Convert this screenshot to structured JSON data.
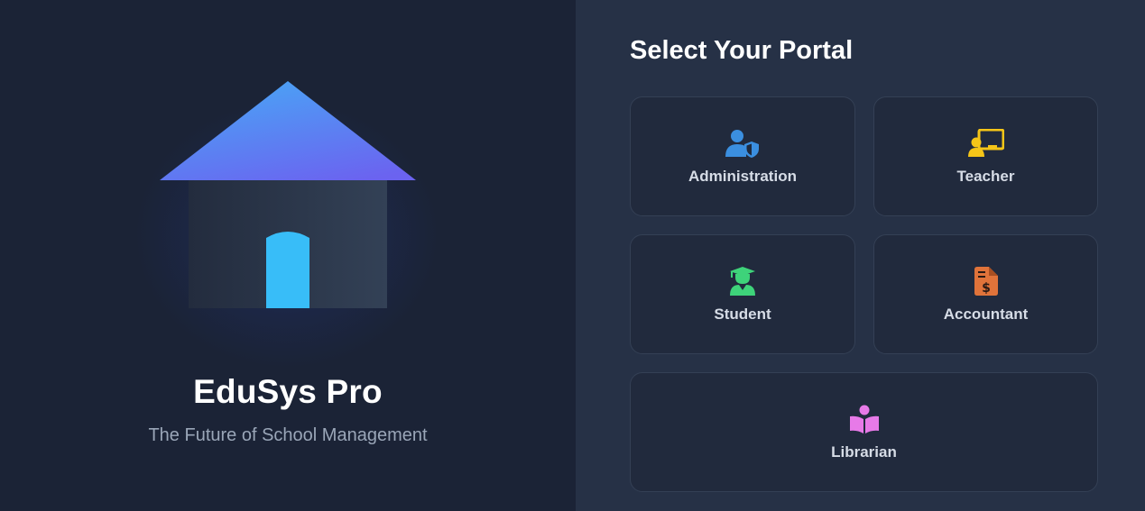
{
  "brand": {
    "name": "EduSys Pro",
    "tagline": "The Future of School Management"
  },
  "portal": {
    "title": "Select Your Portal",
    "cards": [
      {
        "label": "Administration",
        "icon": "user-shield-icon",
        "color": "#3b8fe0"
      },
      {
        "label": "Teacher",
        "icon": "chalkboard-teacher-icon",
        "color": "#f5c518"
      },
      {
        "label": "Student",
        "icon": "user-graduate-icon",
        "color": "#3ed37a"
      },
      {
        "label": "Accountant",
        "icon": "file-invoice-dollar-icon",
        "color": "#e0733a"
      },
      {
        "label": "Librarian",
        "icon": "book-reader-icon",
        "color": "#e77ae8"
      }
    ]
  },
  "colors": {
    "left_bg": "#1b2336",
    "right_bg": "#263146",
    "card_bg": "#212a3d",
    "roof_top": "#4aa3f5",
    "roof_bottom": "#6b63f0",
    "door": "#38bdf8"
  }
}
